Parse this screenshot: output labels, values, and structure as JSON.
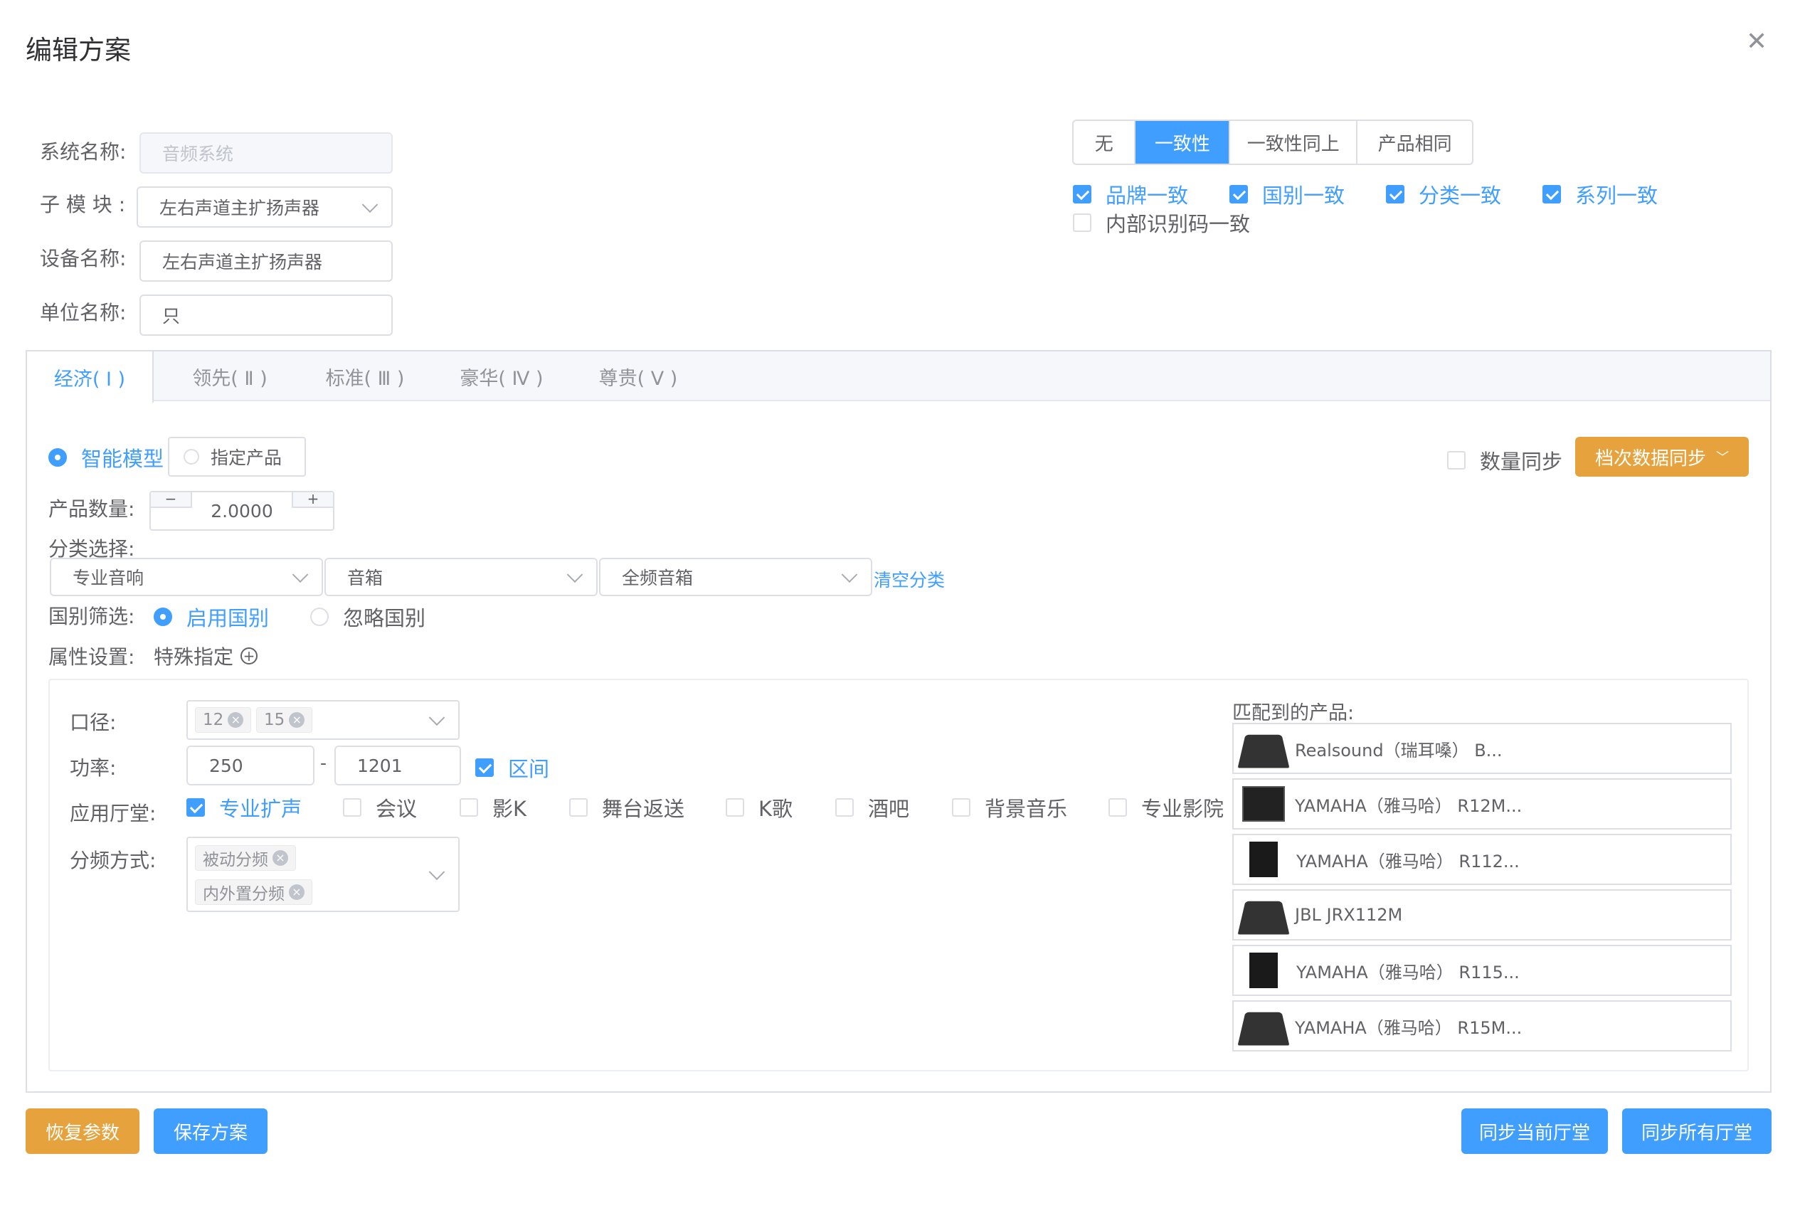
{
  "dialog": {
    "title": "编辑方案",
    "close_icon": "close-icon"
  },
  "form": {
    "system_name_label": "系统名称:",
    "system_name_value": "音频系统",
    "submodule_label": "子 模 块 :",
    "submodule_value": "左右声道主扩扬声器",
    "device_name_label": "设备名称:",
    "device_name_value": "左右声道主扩扬声器",
    "unit_name_label": "单位名称:",
    "unit_name_value": "只"
  },
  "consistency": {
    "segments": [
      {
        "label": "无",
        "active": false
      },
      {
        "label": "一致性",
        "active": true
      },
      {
        "label": "一致性同上",
        "active": false
      },
      {
        "label": "产品相同",
        "active": false
      }
    ],
    "checks": [
      {
        "label": "品牌一致",
        "checked": true
      },
      {
        "label": "国别一致",
        "checked": true
      },
      {
        "label": "分类一致",
        "checked": true
      },
      {
        "label": "系列一致",
        "checked": true
      },
      {
        "label": "内部识别码一致",
        "checked": false
      }
    ]
  },
  "tabs": [
    {
      "label": "经济( I )",
      "active": true
    },
    {
      "label": "领先( Ⅱ )",
      "active": false
    },
    {
      "label": "标准( Ⅲ )",
      "active": false
    },
    {
      "label": "豪华( Ⅳ )",
      "active": false
    },
    {
      "label": "尊贵( Ⅴ )",
      "active": false
    }
  ],
  "mode": {
    "smart_label": "智能模型",
    "specified_label": "指定产品",
    "selected": "smart"
  },
  "sync": {
    "qty_sync_label": "数量同步",
    "qty_sync_checked": false,
    "tier_sync_label": "档次数据同步"
  },
  "quantity": {
    "label": "产品数量:",
    "value": "2.0000",
    "minus": "−",
    "plus": "+"
  },
  "category": {
    "label": "分类选择:",
    "level1": "专业音响",
    "level2": "音箱",
    "level3": "全频音箱",
    "clear_label": "清空分类"
  },
  "country_filter": {
    "label": "国别筛选:",
    "enable_label": "启用国别",
    "ignore_label": "忽略国别",
    "selected": "enable"
  },
  "attributes": {
    "label": "属性设置:",
    "special_label": "特殊指定",
    "add_icon": "plus-circle-icon"
  },
  "params": {
    "diameter_label": "口径:",
    "diameter_tags": [
      "12",
      "15"
    ],
    "power_label": "功率:",
    "power_min": "250",
    "power_sep": "-",
    "power_max": "1201",
    "range_label": "区间",
    "range_checked": true,
    "hall_label": "应用厅堂:",
    "halls": [
      {
        "label": "专业扩声",
        "checked": true
      },
      {
        "label": "会议",
        "checked": false
      },
      {
        "label": "影K",
        "checked": false
      },
      {
        "label": "舞台返送",
        "checked": false
      },
      {
        "label": "K歌",
        "checked": false
      },
      {
        "label": "酒吧",
        "checked": false
      },
      {
        "label": "背景音乐",
        "checked": false
      },
      {
        "label": "专业影院",
        "checked": false
      }
    ],
    "crossover_label": "分频方式:",
    "crossover_tags": [
      "被动分频",
      "内外置分频"
    ]
  },
  "matched": {
    "label": "匹配到的产品:",
    "products": [
      {
        "name": "Realsound（瑞耳嗓） B...",
        "icon": "monitor-speaker-icon"
      },
      {
        "name": "YAMAHA（雅马哈） R12M...",
        "icon": "cabinet-speaker-icon"
      },
      {
        "name": "YAMAHA（雅马哈） R112...",
        "icon": "tall-speaker-icon"
      },
      {
        "name": "JBL JRX112M",
        "icon": "monitor-speaker-icon"
      },
      {
        "name": "YAMAHA（雅马哈） R115...",
        "icon": "tall-speaker-icon"
      },
      {
        "name": "YAMAHA（雅马哈） R15M...",
        "icon": "monitor-speaker-icon"
      }
    ]
  },
  "footer": {
    "restore_label": "恢复参数",
    "save_label": "保存方案",
    "sync_current_label": "同步当前厅堂",
    "sync_all_label": "同步所有厅堂"
  },
  "colors": {
    "primary": "#409eff",
    "warning": "#e6a23c",
    "border": "#dcdfe6",
    "text": "#606266"
  }
}
